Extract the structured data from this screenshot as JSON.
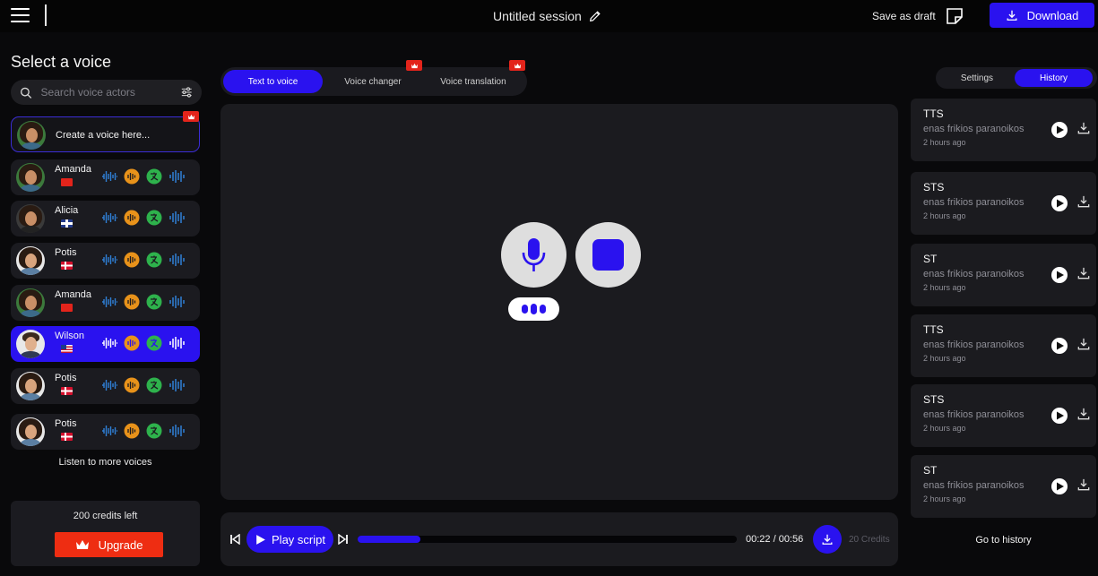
{
  "header": {
    "session_title": "Untitled session",
    "save_draft_label": "Save as draft",
    "download_label": "Download"
  },
  "sidebar": {
    "title": "Select a voice",
    "search_placeholder": "Search voice actors",
    "create_label": "Create a voice here...",
    "voices": [
      {
        "name": "Amanda",
        "flag": "china"
      },
      {
        "name": "Alicia",
        "flag": "united-kingdom"
      },
      {
        "name": "Potis",
        "flag": "denmark"
      },
      {
        "name": "Amanda",
        "flag": "china"
      },
      {
        "name": "Wilson",
        "flag": "united-states",
        "selected": true
      },
      {
        "name": "Potis",
        "flag": "denmark"
      },
      {
        "name": "Potis",
        "flag": "denmark"
      }
    ],
    "more_voices_label": "Listen to more voices",
    "credits_left": "200 credits left",
    "upgrade_label": "Upgrade"
  },
  "mode_tabs": [
    {
      "label": "Text to voice",
      "active": true
    },
    {
      "label": "Voice changer",
      "premium": true
    },
    {
      "label": "Voice translation",
      "premium": true
    }
  ],
  "player": {
    "play_label": "Play script",
    "time": "00:22 / 00:56",
    "progress_fraction": 0.166,
    "credits_cost": "20 Credits"
  },
  "right_panel": {
    "tabs": [
      {
        "label": "Settings",
        "active": false
      },
      {
        "label": "History",
        "active": true
      }
    ],
    "history": [
      {
        "type": "TTS",
        "text": "enas frikios paranoikos",
        "time": "2 hours ago"
      },
      {
        "type": "STS",
        "text": "enas frikios paranoikos",
        "time": "2 hours ago"
      },
      {
        "type": "ST",
        "text": "enas frikios paranoikos",
        "time": "2 hours ago"
      },
      {
        "type": "TTS",
        "text": "enas frikios paranoikos",
        "time": "2 hours ago"
      },
      {
        "type": "STS",
        "text": "enas frikios paranoikos",
        "time": "2 hours ago"
      },
      {
        "type": "ST",
        "text": "enas frikios paranoikos",
        "time": "2 hours ago"
      }
    ],
    "go_history_label": "Go to history"
  },
  "colors": {
    "accent": "#2a12ef",
    "premium": "#e3241b",
    "upgrade": "#ee2d12",
    "background": "#09090b",
    "panel": "#1b1b1f"
  },
  "icons": [
    "menu-icon",
    "edit-icon",
    "save-draft-icon",
    "download-icon",
    "search-icon",
    "filter-icon",
    "crown-icon",
    "waveform-icon",
    "sound-icon",
    "translate-icon",
    "equalizer-icon",
    "microphone-icon",
    "stop-icon",
    "skip-back-icon",
    "play-icon",
    "skip-forward-icon"
  ]
}
